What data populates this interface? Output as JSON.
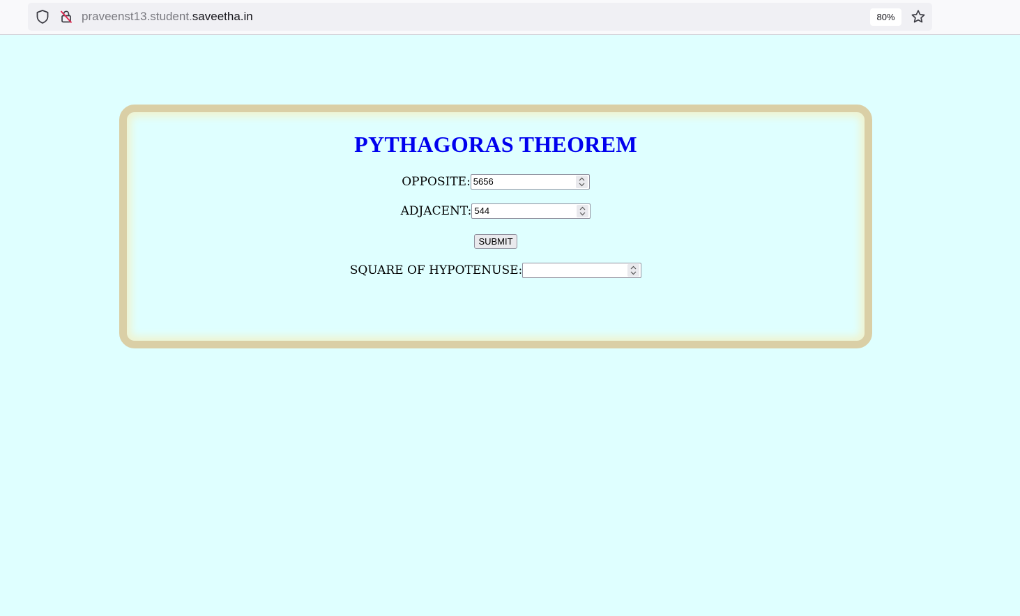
{
  "browser": {
    "url_prefix": "praveenst13.student.",
    "url_domain": "saveetha.in",
    "zoom": "80%"
  },
  "page": {
    "title": "PYTHAGORAS THEOREM",
    "opposite": {
      "label": "OPPOSITE:",
      "value": "5656"
    },
    "adjacent": {
      "label": "ADJACENT:",
      "value": "544"
    },
    "submit_label": "SUBMIT",
    "hypotenuse": {
      "label": "SQUARE OF HYPOTENUSE:",
      "value": ""
    }
  },
  "colors": {
    "page_background": "#dfffff",
    "card_border": "#dacfa6",
    "title": "#0000ee"
  },
  "icons": {
    "shield": "tracking-protection-shield-icon",
    "lock": "insecure-lock-icon",
    "star": "bookmark-star-icon"
  }
}
